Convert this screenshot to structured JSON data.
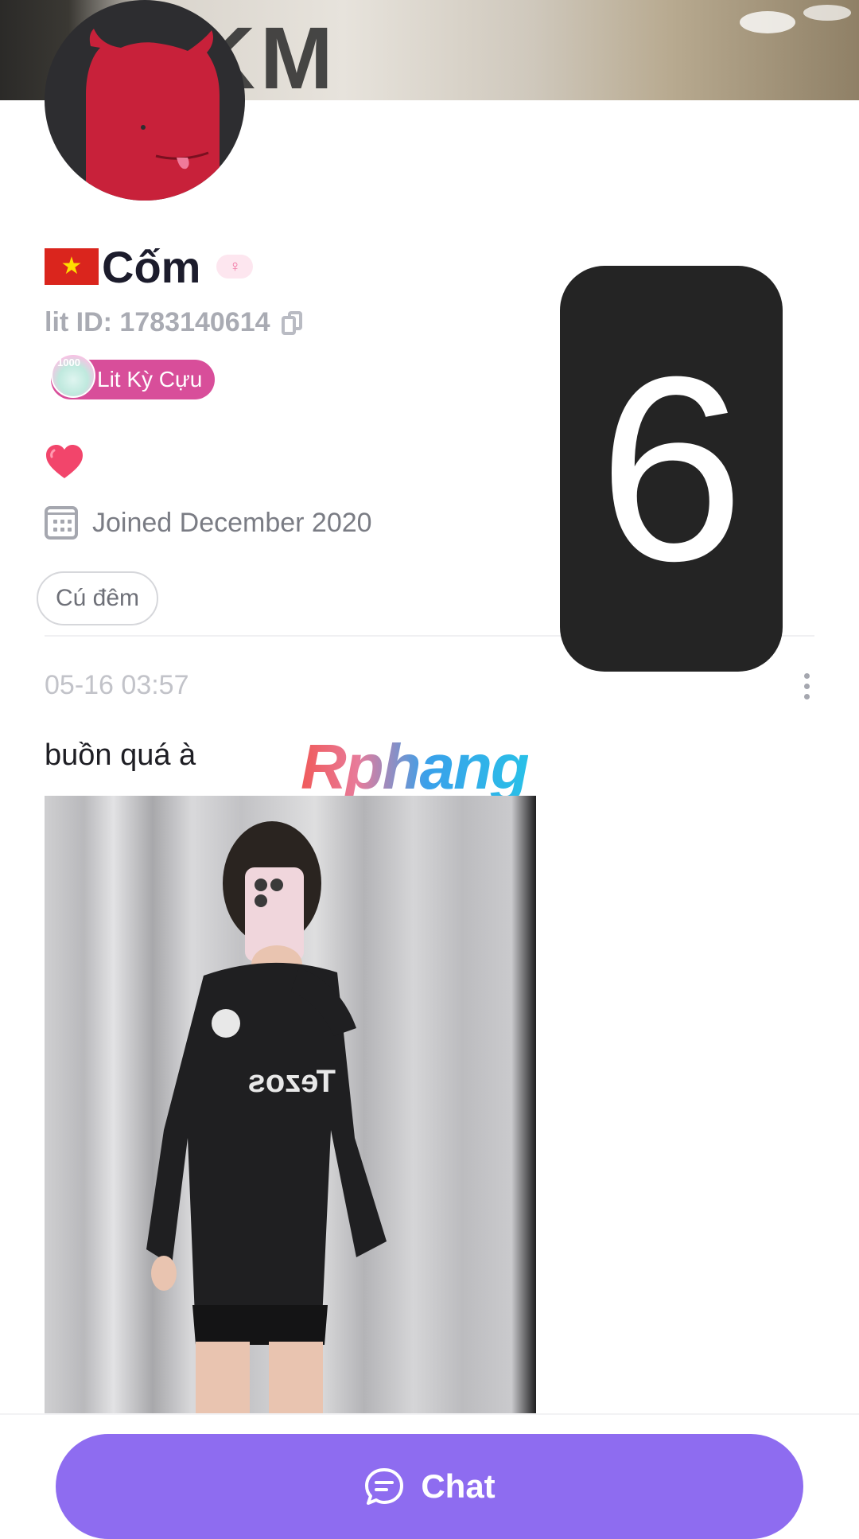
{
  "profile": {
    "name": "Cốm",
    "lit_id": "lit ID: 1783140614",
    "badge_label": "Lit Kỳ Cựu",
    "badge_number": "1000",
    "joined": "Joined December 2020",
    "tag": "Cú đêm",
    "cover_text": "OKM"
  },
  "overlay": {
    "number": "6"
  },
  "post": {
    "timestamp": "05-16 03:57",
    "text": "buồn quá à",
    "watermark": "Rphang",
    "shirt_text": "Tezos"
  },
  "actions": {
    "chat_label": "Chat"
  },
  "colors": {
    "primary": "#8e6cf0",
    "badge": "#d84e9a",
    "avatar_red": "#c8213a",
    "heart": "#f2456b"
  },
  "icons": {
    "flag": "vietnam-flag-icon",
    "gender": "female-gender-icon",
    "copy": "copy-icon",
    "calendar": "calendar-icon",
    "more": "more-vertical-icon",
    "chat": "chat-bubble-icon"
  }
}
